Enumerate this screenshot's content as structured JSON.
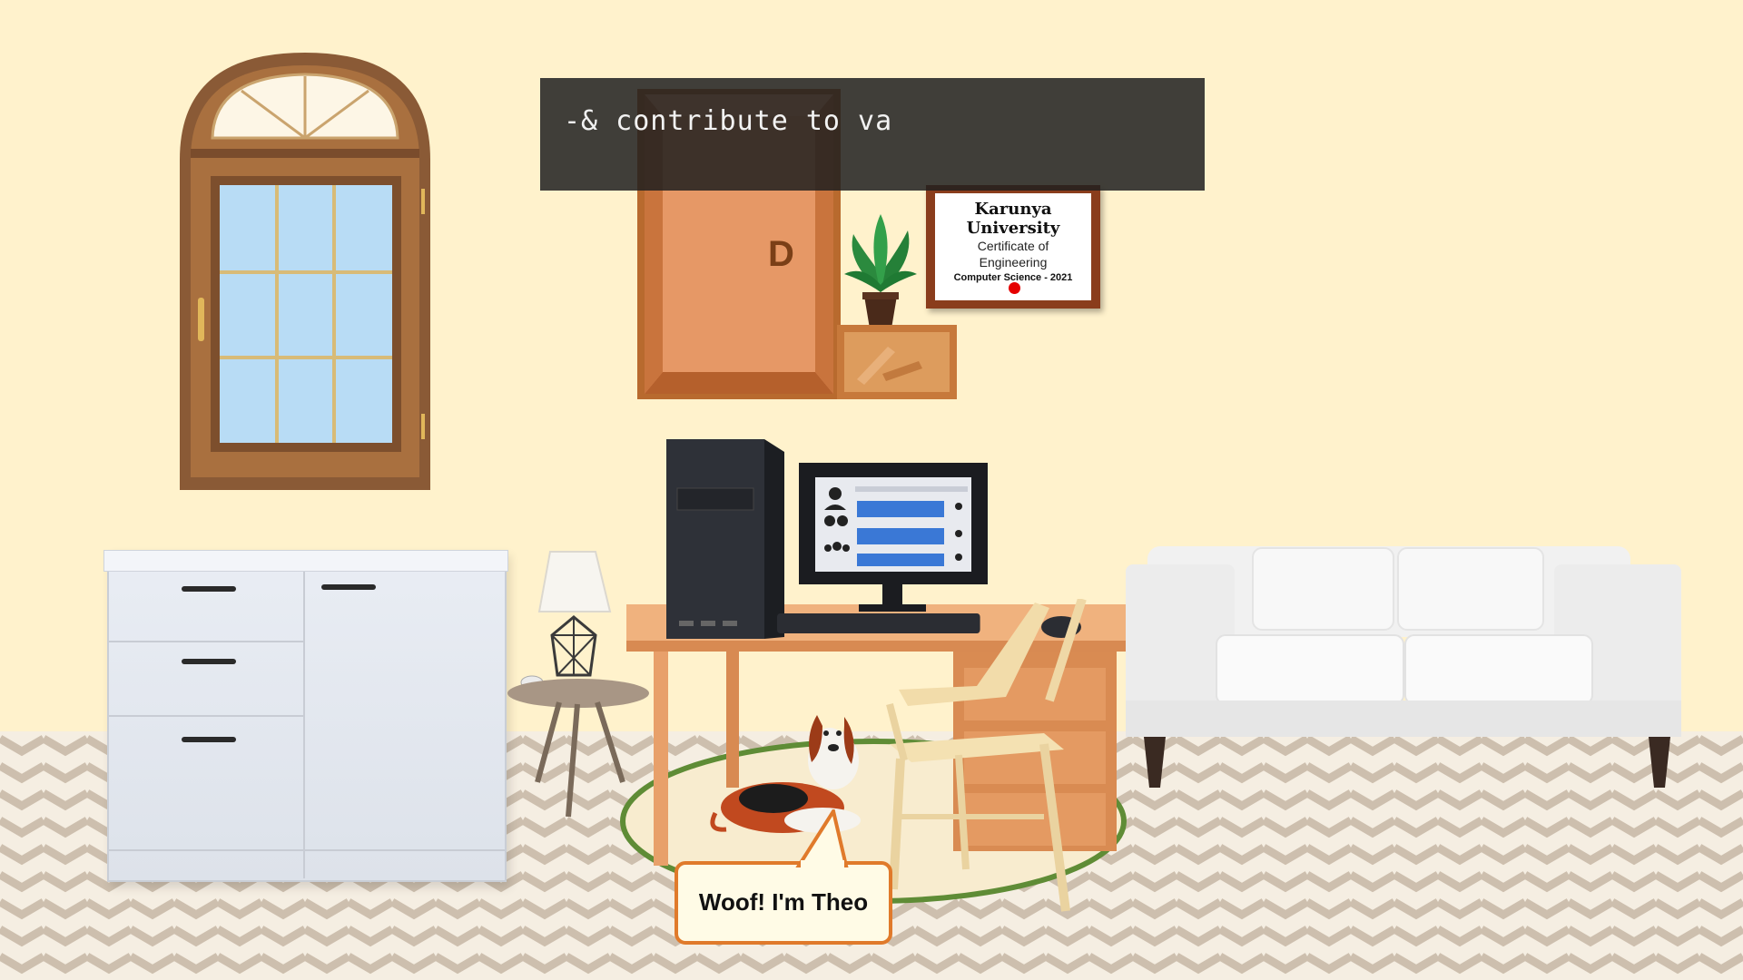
{
  "typing_box": {
    "text": "-& contribute to va"
  },
  "door": {
    "letter": "D"
  },
  "certificate": {
    "university": "Karunya University",
    "line1": "Certificate of",
    "line2": "Engineering",
    "line3": "Computer Science - 2021"
  },
  "speech_bubble": {
    "text": "Woof! I'm Theo"
  },
  "colors": {
    "wall": "#fff2cc",
    "typing_box_bg": "#2a2a2a",
    "speech_border": "#e07a2b",
    "screen_bar": "#3a78d6",
    "cursor_dot": "#e50000"
  }
}
